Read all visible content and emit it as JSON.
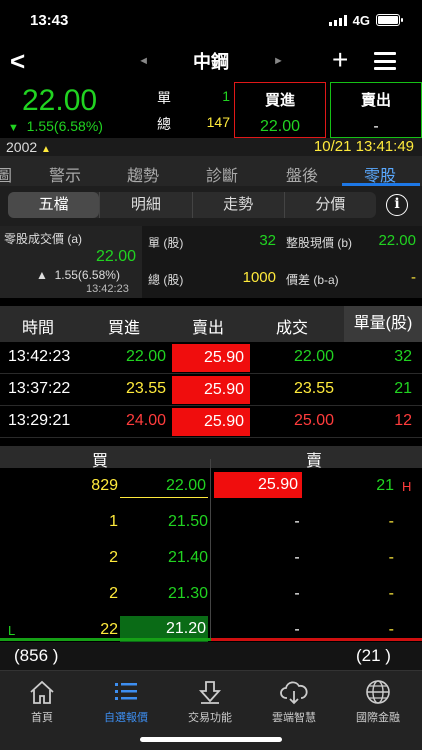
{
  "status": {
    "time": "13:43",
    "network": "4G"
  },
  "nav": {
    "title": "中鋼"
  },
  "quote": {
    "price": "22.00",
    "change": "1.55(6.58%)",
    "label_single": "單",
    "value_single": "1",
    "label_total": "總",
    "value_total": "147",
    "buy_label": "買進",
    "buy_value": "22.00",
    "sell_label": "賣出",
    "sell_value": "-"
  },
  "subbar": {
    "code": "2002",
    "datetime": "10/21 13:41:49"
  },
  "main_tabs": [
    "圖",
    "警示",
    "趨勢",
    "診斷",
    "盤後",
    "零股"
  ],
  "sub_tabs": [
    "五檔",
    "明細",
    "走勢",
    "分價"
  ],
  "odd_lot": {
    "price_label": "零股成交價 (a)",
    "price": "22.00",
    "change": "1.55(6.58%)",
    "time": "13:42:23",
    "unit_label": "單 (股)",
    "unit_value": "32",
    "total_label": "總 (股)",
    "total_value": "1000",
    "whole_label": "整股現價 (b)",
    "whole_value": "22.00",
    "diff_label": "價差 (b-a)",
    "diff_value": "-"
  },
  "trades": {
    "headers": [
      "時間",
      "買進",
      "賣出",
      "成交",
      "單量(股)"
    ],
    "rows": [
      {
        "time": "13:42:23",
        "bid": "22.00",
        "ask": "25.90",
        "deal": "22.00",
        "vol": "32"
      },
      {
        "time": "13:37:22",
        "bid": "23.55",
        "ask": "25.90",
        "deal": "23.55",
        "vol": "21"
      },
      {
        "time": "13:29:21",
        "bid": "24.00",
        "ask": "25.90",
        "deal": "25.00",
        "vol": "12"
      }
    ]
  },
  "book": {
    "buy_label": "買",
    "sell_label": "賣",
    "rows": [
      {
        "bid_vol": "829",
        "bid": "22.00",
        "ask": "25.90",
        "ask_vol": "21",
        "flag": "H"
      },
      {
        "bid_vol": "1",
        "bid": "21.50",
        "ask": "-",
        "ask_vol": "-"
      },
      {
        "bid_vol": "2",
        "bid": "21.40",
        "ask": "-",
        "ask_vol": "-"
      },
      {
        "bid_vol": "2",
        "bid": "21.30",
        "ask": "-",
        "ask_vol": "-"
      },
      {
        "bid_vol": "22",
        "bid": "21.20",
        "ask": "-",
        "ask_vol": "-",
        "flag": "L"
      }
    ],
    "bid_total": "(856 )",
    "ask_total": "(21 )"
  },
  "tabbar": [
    {
      "label": "首頁",
      "icon": "home-icon"
    },
    {
      "label": "自選報價",
      "icon": "list-icon"
    },
    {
      "label": "交易功能",
      "icon": "trade-icon"
    },
    {
      "label": "雲端智慧",
      "icon": "cloud-icon"
    },
    {
      "label": "國際金融",
      "icon": "globe-icon"
    }
  ],
  "colors": {
    "up": "#21d321",
    "highlight": "#ffea3c",
    "down": "#f00d0d",
    "accent": "#1e78e6"
  }
}
